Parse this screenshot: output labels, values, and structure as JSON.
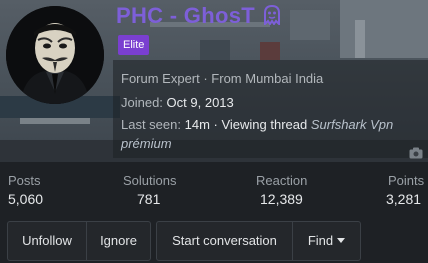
{
  "profile": {
    "username": "PHC - GhosT",
    "badge": "Elite",
    "title_line": "Forum Expert · From Mumbai India",
    "joined_label": "Joined:",
    "joined_value": "Oct 9, 2013",
    "lastseen_label": "Last seen:",
    "lastseen_value": "14m · Viewing thread",
    "thread_title_1": "Surfshark Vpn",
    "thread_title_2": "prémium",
    "name_color": "#7d5fd8",
    "badge_color": "#7a3fd0"
  },
  "stats": [
    {
      "label": "Posts",
      "value": "5,060"
    },
    {
      "label": "Solutions",
      "value": "781"
    },
    {
      "label": "Reaction",
      "value": "12,389"
    },
    {
      "label": "Points",
      "value": "3,281"
    }
  ],
  "actions": {
    "unfollow": "Unfollow",
    "ignore": "Ignore",
    "start_conversation": "Start conversation",
    "find": "Find"
  },
  "icons": {
    "ghost": "ghost-emoji-icon",
    "camera": "camera-icon",
    "caret": "caret-down-icon"
  }
}
